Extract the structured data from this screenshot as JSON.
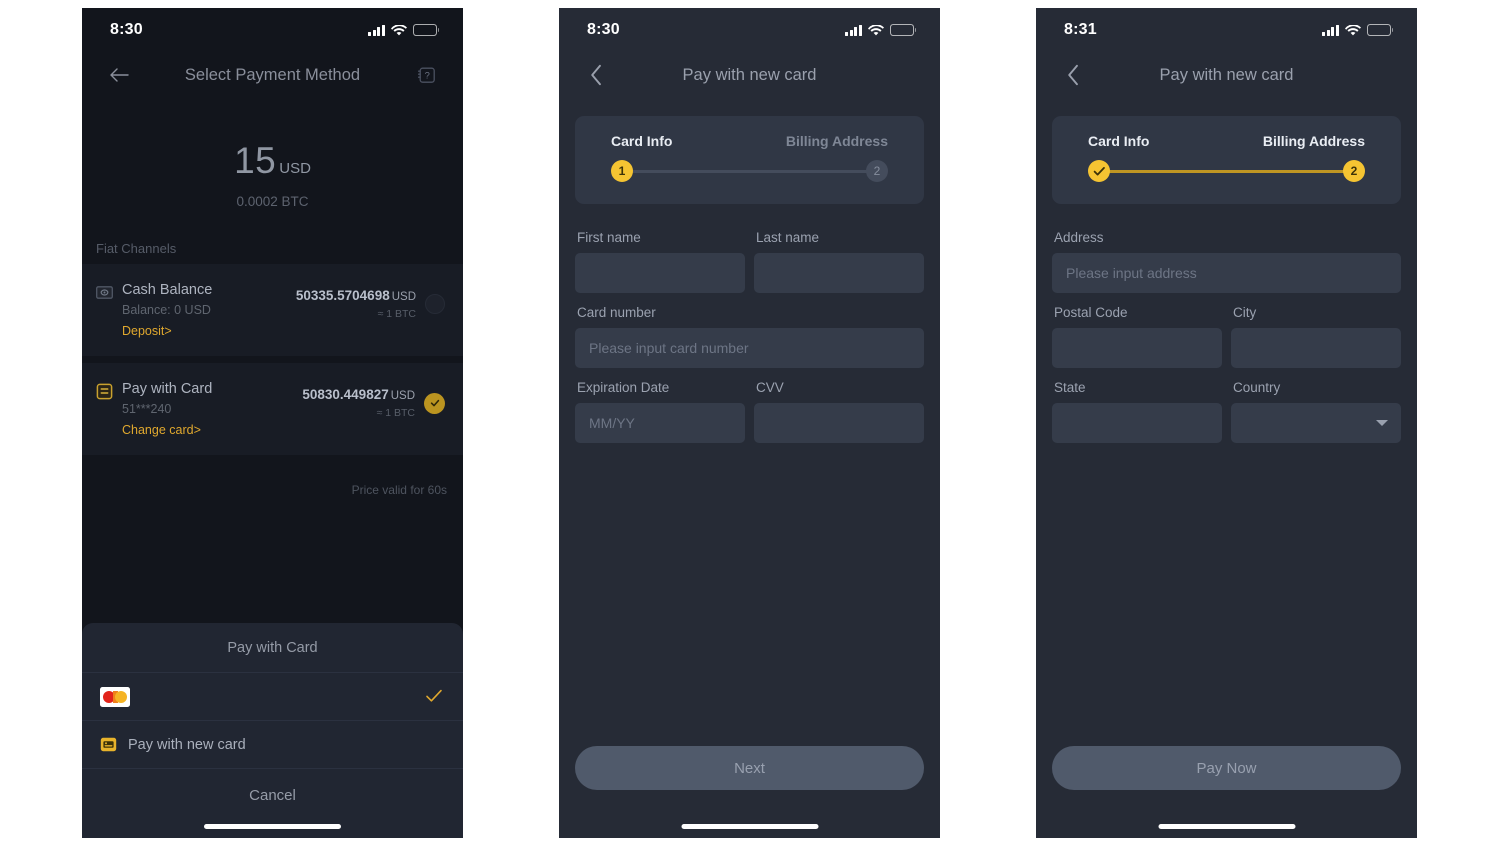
{
  "screens": [
    {
      "id": "select-payment-method",
      "statusbar": {
        "time": "8:30"
      },
      "nav": {
        "title": "Select Payment Method",
        "back_icon": "arrow-left-icon",
        "help_icon": "help-question-icon"
      },
      "amount": {
        "value": "15",
        "currency": "USD",
        "crypto": "0.0002 BTC"
      },
      "section_label": "Fiat Channels",
      "methods": [
        {
          "icon": "banknote-icon",
          "title": "Cash Balance",
          "subtitle": "Balance:  0 USD",
          "link": "Deposit>",
          "rate": "50335.5704698",
          "rate_currency": "USD",
          "rate_sub": "≈ 1 BTC",
          "selected": false
        },
        {
          "icon": "card-icon",
          "title": "Pay with Card",
          "subtitle": "51***240",
          "link": "Change card>",
          "rate": "50830.449827",
          "rate_currency": "USD",
          "rate_sub": "≈ 1  BTC",
          "selected": true
        }
      ],
      "price_valid": "Price valid for 60s",
      "sheet": {
        "title": "Pay with Card",
        "options": [
          {
            "icon": "mastercard-icon",
            "label": "",
            "checked": true
          },
          {
            "icon": "new-card-icon",
            "label": "Pay with new card",
            "checked": false
          }
        ],
        "cancel_label": "Cancel"
      }
    },
    {
      "id": "pay-with-new-card-step1",
      "statusbar": {
        "time": "8:30"
      },
      "nav": {
        "title": "Pay with new card",
        "back_icon": "chevron-left-icon"
      },
      "stepper": {
        "steps": [
          {
            "label": "Card Info",
            "marker": "1",
            "state": "active"
          },
          {
            "label": "Billing Address",
            "marker": "2",
            "state": "inactive"
          }
        ],
        "track": "dim"
      },
      "fields": [
        {
          "label": "First name",
          "value": "",
          "placeholder": ""
        },
        {
          "label": "Last name",
          "value": "",
          "placeholder": ""
        },
        {
          "label": "Card number",
          "value": "",
          "placeholder": "Please input card number"
        },
        {
          "label": "Expiration Date",
          "value": "",
          "placeholder": "MM/YY"
        },
        {
          "label": "CVV",
          "value": "",
          "placeholder": ""
        }
      ],
      "cta_label": "Next"
    },
    {
      "id": "pay-with-new-card-step2",
      "statusbar": {
        "time": "8:31"
      },
      "nav": {
        "title": "Pay with new card",
        "back_icon": "chevron-left-icon"
      },
      "stepper": {
        "steps": [
          {
            "label": "Card Info",
            "marker": "✓",
            "state": "done"
          },
          {
            "label": "Billing Address",
            "marker": "2",
            "state": "active"
          }
        ],
        "track": "lit"
      },
      "fields": [
        {
          "label": "Address",
          "value": "",
          "placeholder": "Please input address"
        },
        {
          "label": "Postal Code",
          "value": "",
          "placeholder": ""
        },
        {
          "label": "City",
          "value": "",
          "placeholder": ""
        },
        {
          "label": "State",
          "value": "",
          "placeholder": ""
        },
        {
          "label": "Country",
          "value": "",
          "placeholder": "",
          "dropdown": true
        }
      ],
      "cta_label": "Pay Now"
    }
  ],
  "colors": {
    "accent_yellow": "#f5c432",
    "link_gold": "#e0a82e",
    "bg_dark": "#12151c",
    "bg_slate": "#262b36",
    "card": "#303745",
    "input": "#353c4a",
    "battery_low": "#e8553a"
  }
}
